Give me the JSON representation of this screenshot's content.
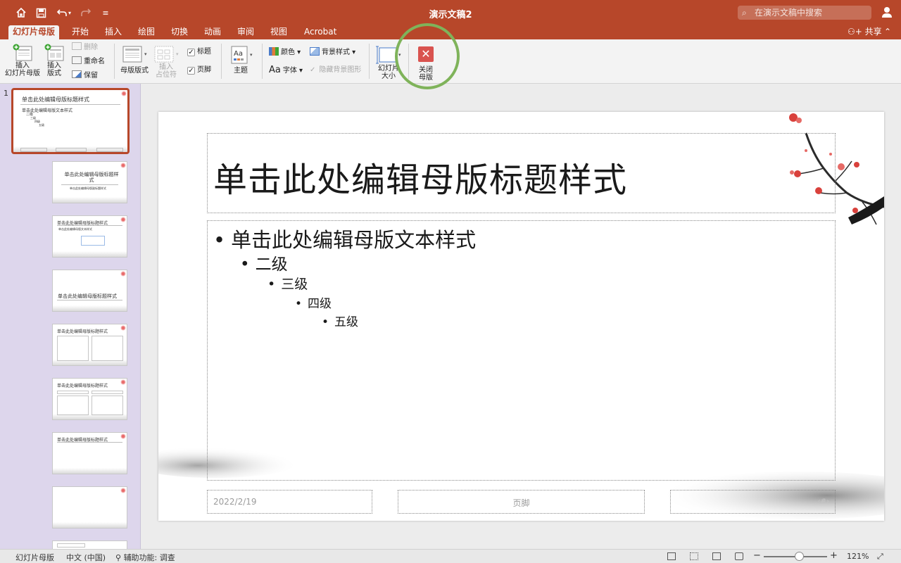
{
  "window": {
    "title": "演示文稿2",
    "search_placeholder": "在演示文稿中搜索"
  },
  "tabs": [
    {
      "label": "幻灯片母版",
      "active": true
    },
    {
      "label": "开始"
    },
    {
      "label": "插入"
    },
    {
      "label": "绘图"
    },
    {
      "label": "切换"
    },
    {
      "label": "动画"
    },
    {
      "label": "审阅"
    },
    {
      "label": "视图"
    },
    {
      "label": "Acrobat"
    }
  ],
  "share_label": "共享",
  "ribbon": {
    "insert_master_l1": "插入",
    "insert_master_l2": "幻灯片母版",
    "insert_layout_l1": "插入",
    "insert_layout_l2": "版式",
    "delete": "删除",
    "rename": "重命名",
    "preserve": "保留",
    "master_layout": "母版版式",
    "insert_ph_l1": "插入",
    "insert_ph_l2": "占位符",
    "chk_title": "标题",
    "chk_footer": "页脚",
    "themes": "主题",
    "colors": "颜色",
    "fonts": "字体",
    "bg_styles": "背景样式",
    "hide_bg": "隐藏背景图形",
    "slide_size_l1": "幻灯片",
    "slide_size_l2": "大小",
    "close_master_l1": "关闭",
    "close_master_l2": "母版"
  },
  "thumbnails": {
    "first_number": "1",
    "master_title": "单击此处编辑母版标题样式",
    "master_text": "单击此处编辑母版文本样式",
    "levels": [
      "二级",
      "三级",
      "四级",
      "五级"
    ],
    "layout_title": "单击此处编辑母版标题样式",
    "layout_subtitle": "单击此处编辑母版副标题样式",
    "layout_text": "单击此处编辑母版文本样式"
  },
  "slide": {
    "title": "单击此处编辑母版标题样式",
    "level1": "单击此处编辑母版文本样式",
    "level2": "二级",
    "level3": "三级",
    "level4": "四级",
    "level5": "五级",
    "date": "2022/2/19",
    "footer": "页脚",
    "number": "‹#›"
  },
  "status": {
    "mode": "幻灯片母版",
    "language": "中文 (中国)",
    "accessibility": "辅助功能: 调查",
    "zoom": "121%",
    "zoom_value": 0.55
  },
  "colors": {
    "accent": "#b7472a",
    "thumb_pane": "#ddd6ec",
    "close_red": "#d9534f",
    "annotation_green": "#7fb35a"
  }
}
